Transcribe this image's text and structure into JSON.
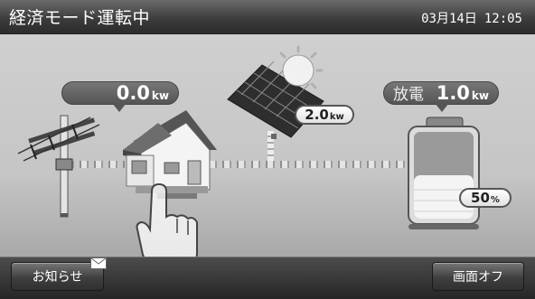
{
  "header": {
    "mode_title": "経済モード運転中",
    "date": "03月14日",
    "time": "12:05"
  },
  "grid_power": {
    "value": "0.0",
    "unit": "kw"
  },
  "solar_power": {
    "value": "2.0",
    "unit": "kw"
  },
  "battery": {
    "status_label": "放電",
    "power_value": "1.0",
    "power_unit": "kw",
    "charge_value": "50",
    "charge_unit": "%",
    "charge_fraction": 0.5
  },
  "buttons": {
    "notice_label": "お知らせ",
    "screen_off_label": "画面オフ"
  },
  "icons": {
    "notice": "mail-icon",
    "grid": "utility-pole-icon",
    "home": "house-icon",
    "solar": "solar-panel-icon",
    "sun": "sun-icon",
    "battery": "battery-icon",
    "touch": "hand-pointer-icon"
  },
  "colors": {
    "titlebar": "#3a3a3a",
    "background": "#c6c6c6",
    "bubble": "#555555"
  }
}
